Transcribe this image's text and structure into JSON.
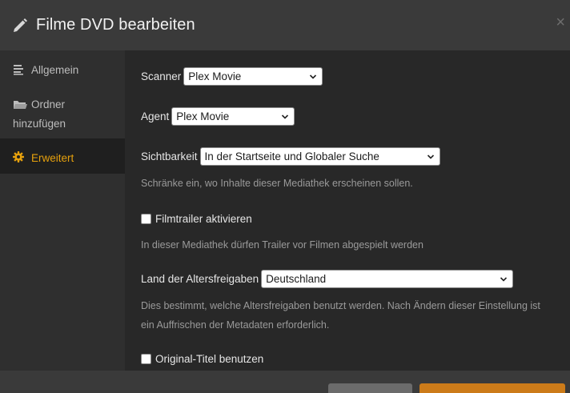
{
  "header": {
    "title": "Filme DVD bearbeiten",
    "close_glyph": "×",
    "icon": "pencil-icon"
  },
  "sidebar": {
    "items": [
      {
        "label": "Allgemein",
        "icon": "lines-icon",
        "active": false
      },
      {
        "label_line1": "Ordner",
        "label_line2": "hinzufügen",
        "icon": "folder-icon",
        "active": false
      },
      {
        "label": "Erweitert",
        "icon": "gear-icon",
        "active": true
      }
    ]
  },
  "form": {
    "scanner": {
      "label": "Scanner",
      "value": "Plex Movie"
    },
    "agent": {
      "label": "Agent",
      "value": "Plex Movie"
    },
    "visibility": {
      "label": "Sichtbarkeit",
      "value": "In der Startseite und Globaler Suche",
      "help": "Schränke ein, wo Inhalte dieser Mediathek erscheinen sollen."
    },
    "trailers": {
      "label": "Filmtrailer aktivieren",
      "checked": false,
      "help": "In dieser Mediathek dürfen Trailer vor Filmen abgespielt werden"
    },
    "rating_country": {
      "label": "Land der Altersfreigaben",
      "value": "Deutschland",
      "help_line1": "Dies bestimmt, welche Altersfreigaben benutzt werden. Nach Ändern dieser Einstellung ist",
      "help_line2": "ein Auffrischen der Metadaten erforderlich."
    },
    "original_title": {
      "label": "Original-Titel benutzen",
      "checked": false
    }
  },
  "colors": {
    "accent": "#e5a00d",
    "save_button": "#cc7b19",
    "cancel_button": "#6b6b6b"
  }
}
